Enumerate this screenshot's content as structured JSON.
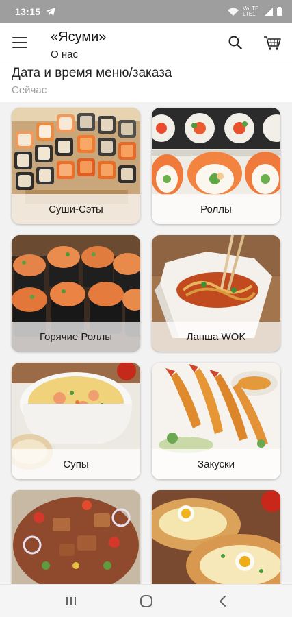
{
  "status_bar": {
    "time": "13:15",
    "network": "VoLTE LTE1"
  },
  "app_bar": {
    "title": "«Ясуми»",
    "subtitle": "О нас"
  },
  "order_time": {
    "label": "Дата и время меню/заказа",
    "value": "Сейчас"
  },
  "categories": [
    {
      "label": "Суши-Сэты"
    },
    {
      "label": "Роллы"
    },
    {
      "label": "Горячие Роллы"
    },
    {
      "label": "Лапша WOK"
    },
    {
      "label": "Супы"
    },
    {
      "label": "Закуски"
    },
    {
      "label": ""
    },
    {
      "label": ""
    }
  ],
  "colors": {
    "status_bar": "#9e9e9e",
    "grid_background": "#f2f2f2",
    "card_caption_bg": "rgba(255,255,255,0.72)"
  }
}
